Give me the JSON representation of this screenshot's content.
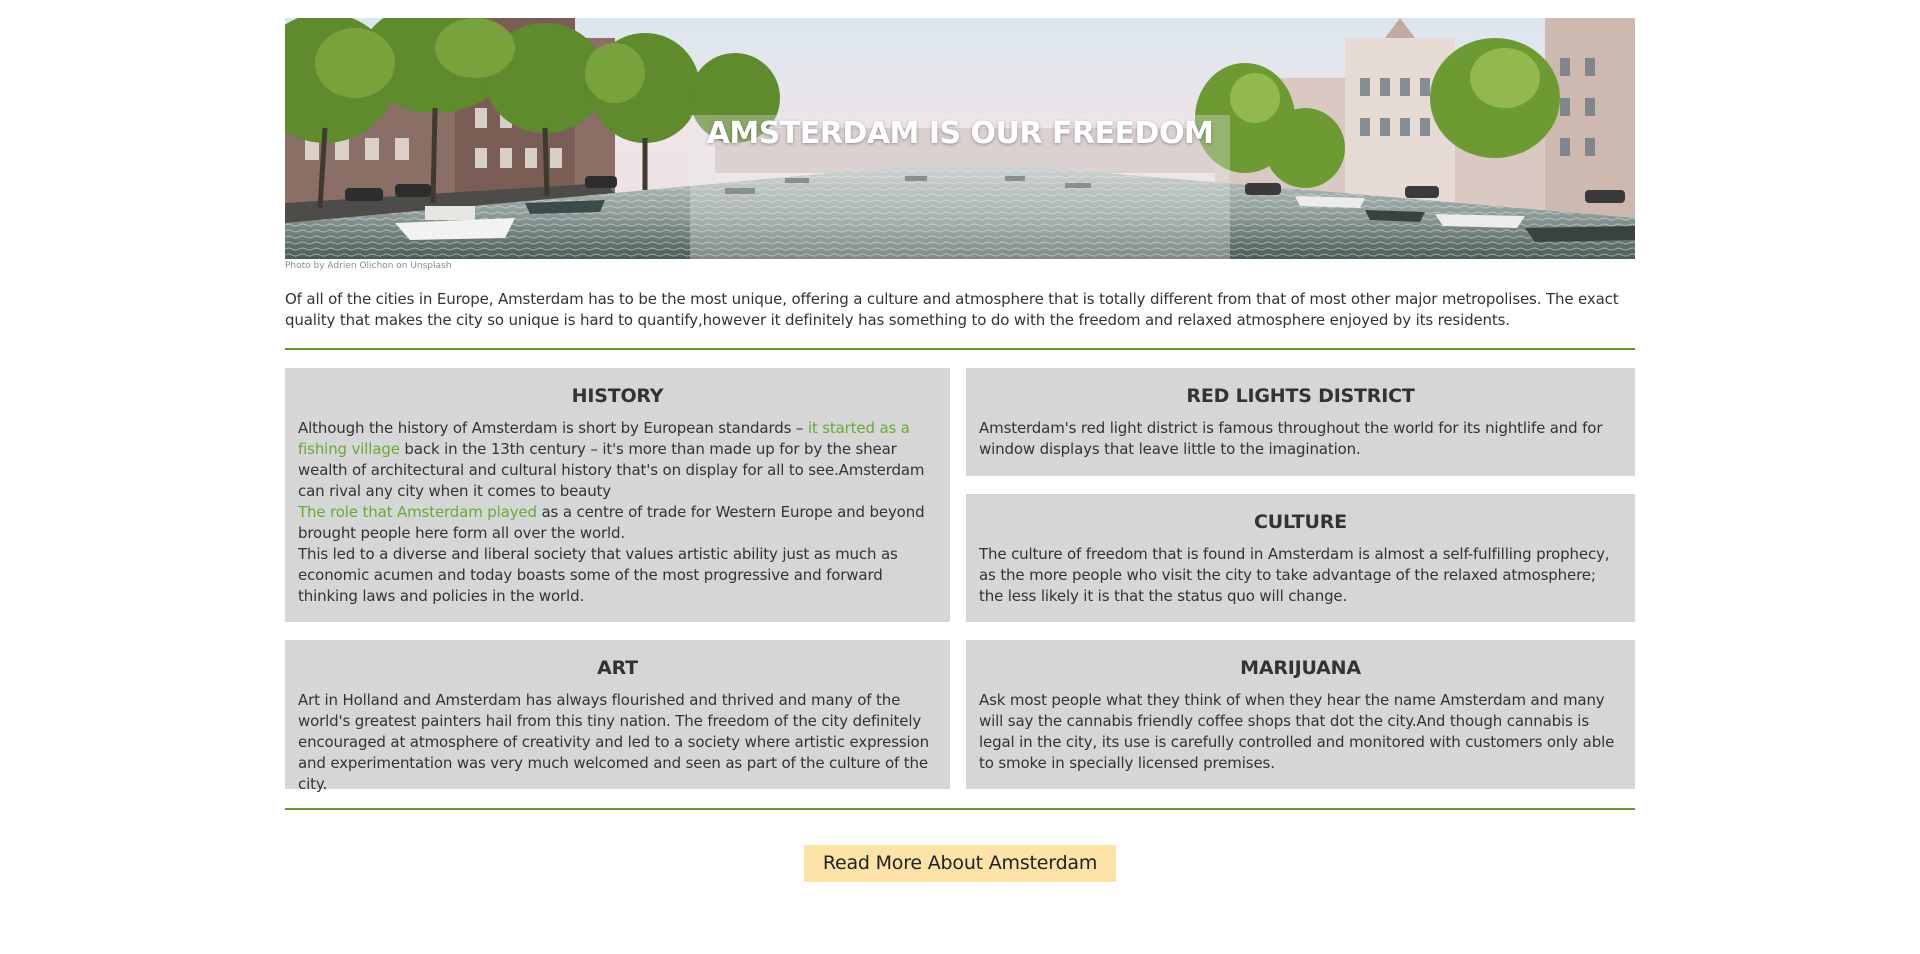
{
  "hero": {
    "title": "AMSTERDAM IS OUR FREEDOM",
    "photo_credit": "Photo by Adrien Olichon on Unsplash"
  },
  "intro": "Of all of the cities in Europe, Amsterdam has to be the most unique, offering a culture and atmosphere that is totally different from that of most other major metropolises. The exact quality that makes the city so unique is hard to quantify,however it definitely has something to do with the freedom and relaxed atmosphere enjoyed by its residents.",
  "history": {
    "title": "HISTORY",
    "p1_before": "Although the history of Amsterdam is short by European standards – ",
    "p1_link": "it started as a fishing village",
    "p1_after": " back in the 13th century – it's more than made up for by the shear wealth of architectural and cultural history that's on display for all to see.Amsterdam can rival any city when it comes to beauty",
    "p2_link": "The role that Amsterdam played",
    "p2_after": " as a centre of trade for Western Europe and beyond brought people here form all over the world.",
    "p3": "This led to a diverse and liberal society that values artistic ability just as much as economic acumen and today boasts some of the most progressive and forward thinking laws and policies in the world."
  },
  "red_lights": {
    "title": "RED LIGHTS DISTRICT",
    "body": "Amsterdam's red light district is famous throughout the world for its nightlife and for window displays that leave little to the imagination."
  },
  "culture": {
    "title": "CULTURE",
    "body": "The culture of freedom that is found in Amsterdam is almost a self-fulfilling prophecy, as the more people who visit the city to take advantage of the relaxed atmosphere; the less likely it is that the status quo will change."
  },
  "art": {
    "title": "ART",
    "body": "Art in Holland and Amsterdam has always flourished and thrived and many of the world's greatest painters hail from this tiny nation. The freedom of the city definitely encouraged at atmosphere of creativity and led to a society where artistic expression and experimentation was very much welcomed and seen as part of the culture of the city."
  },
  "marijuana": {
    "title": "MARIJUANA",
    "body": "Ask most people what they think of when they hear the name Amsterdam and many will say the cannabis friendly coffee shops that dot the city.And though cannabis is legal in the city, its use is carefully controlled and monitored with customers only able to smoke in specially licensed premises."
  },
  "button": {
    "label": "Read More About Amsterdam"
  },
  "colors": {
    "accent_green": "#5e9e2c",
    "link_green": "#6aa83a",
    "card_bg": "#d6d6d6",
    "button_bg": "#fde3a7",
    "text": "#333333"
  }
}
